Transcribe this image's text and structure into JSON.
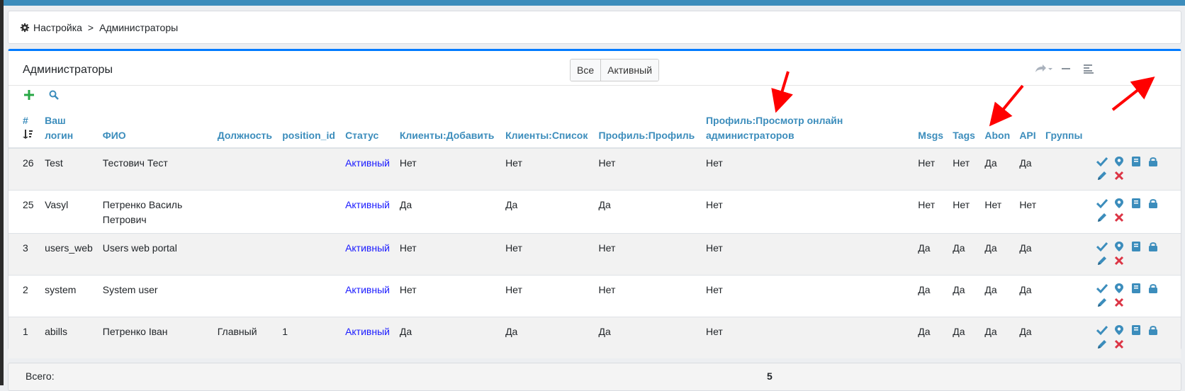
{
  "breadcrumb": {
    "root": "Настройка",
    "separator": ">",
    "current": "Администраторы"
  },
  "panel": {
    "title": "Администраторы",
    "filters": [
      "Все",
      "Активный"
    ]
  },
  "table": {
    "columns": {
      "id": "#",
      "login": "Ваш логин",
      "fio": "ФИО",
      "position": "Должность",
      "position_id": "position_id",
      "status": "Статус",
      "clients_add": "Клиенты:Добавить",
      "clients_list": "Клиенты:Список",
      "profile": "Профиль:Профиль",
      "profile_view": "Профиль:Просмотр онлайн администраторов",
      "msgs": "Msgs",
      "tags": "Tags",
      "abon": "Abon",
      "api": "API",
      "groups": "Группы"
    },
    "rows": [
      {
        "id": "26",
        "login": "Test",
        "fio": "Тестович Тест",
        "position": "",
        "position_id": "",
        "status": "Активный",
        "clients_add": "Нет",
        "clients_list": "Нет",
        "profile": "Нет",
        "profile_view": "Нет",
        "msgs": "Нет",
        "tags": "Нет",
        "abon": "Да",
        "api": "Да",
        "groups": ""
      },
      {
        "id": "25",
        "login": "Vasyl",
        "fio": "Петренко Василь Петрович",
        "position": "",
        "position_id": "",
        "status": "Активный",
        "clients_add": "Да",
        "clients_list": "Да",
        "profile": "Да",
        "profile_view": "Нет",
        "msgs": "Нет",
        "tags": "Нет",
        "abon": "Нет",
        "api": "Нет",
        "groups": ""
      },
      {
        "id": "3",
        "login": "users_web",
        "fio": "Users web portal",
        "position": "",
        "position_id": "",
        "status": "Активный",
        "clients_add": "Нет",
        "clients_list": "Нет",
        "profile": "Нет",
        "profile_view": "Нет",
        "msgs": "Да",
        "tags": "Да",
        "abon": "Да",
        "api": "Да",
        "groups": ""
      },
      {
        "id": "2",
        "login": "system",
        "fio": "System user",
        "position": "",
        "position_id": "",
        "status": "Активный",
        "clients_add": "Нет",
        "clients_list": "Нет",
        "profile": "Нет",
        "profile_view": "Нет",
        "msgs": "Да",
        "tags": "Да",
        "abon": "Да",
        "api": "Да",
        "groups": ""
      },
      {
        "id": "1",
        "login": "abills",
        "fio": "Петренко Іван",
        "position": "Главный",
        "position_id": "1",
        "status": "Активный",
        "clients_add": "Да",
        "clients_list": "Да",
        "profile": "Да",
        "profile_view": "Нет",
        "msgs": "Да",
        "tags": "Да",
        "abon": "Да",
        "api": "Да",
        "groups": ""
      }
    ]
  },
  "footer": {
    "total_label": "Всего:",
    "total_value": "5"
  },
  "colors": {
    "accent": "#3c8dbc",
    "primary": "#007bff",
    "add": "#28a745",
    "delete": "#dc3545",
    "annotation_arrow": "#ff0000"
  },
  "icons": [
    "gear-icon",
    "plus-icon",
    "search-icon",
    "sort-icon",
    "share-icon",
    "minimize-icon",
    "columns-icon",
    "check-icon",
    "location-icon",
    "book-icon",
    "lock-icon",
    "edit-icon",
    "delete-icon"
  ]
}
